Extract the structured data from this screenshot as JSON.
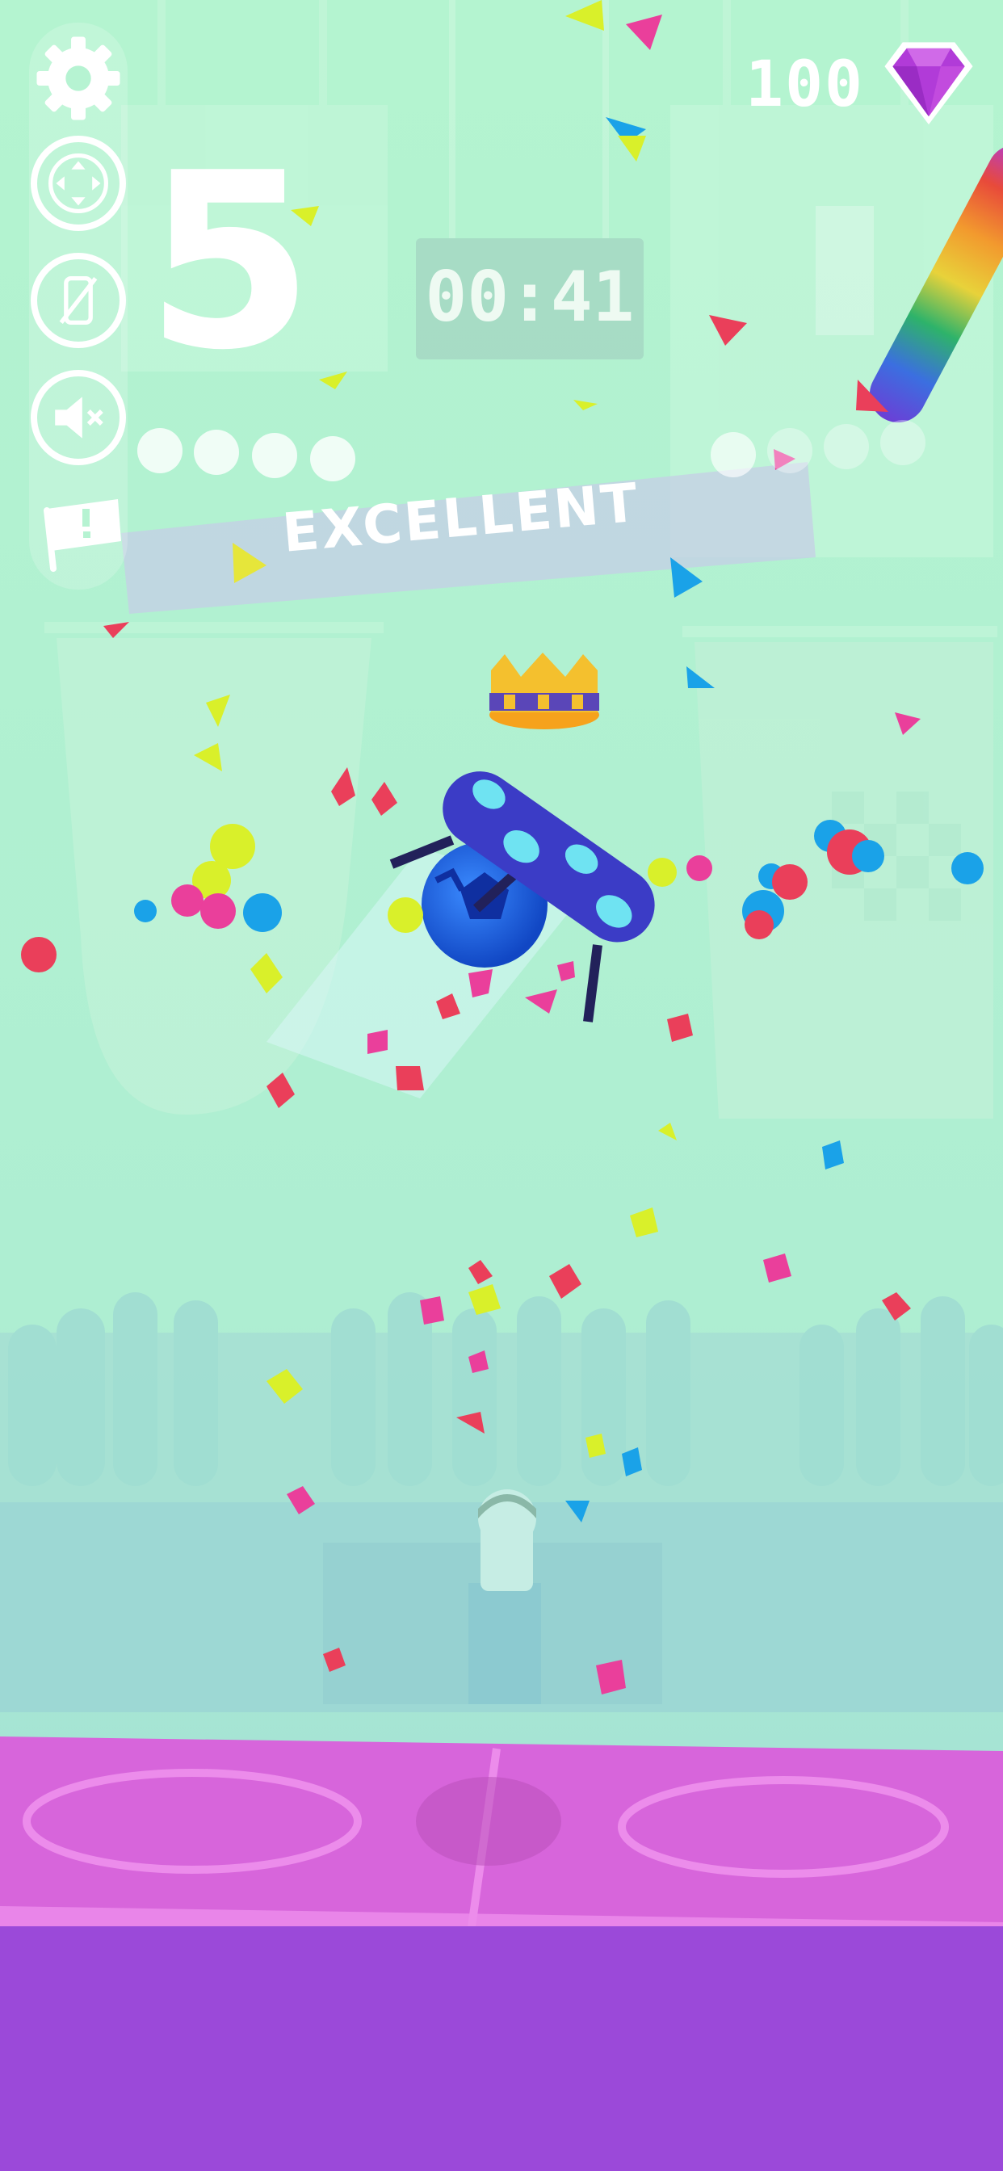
{
  "hud": {
    "buttons": [
      {
        "name": "settings",
        "icon": "gear-icon"
      },
      {
        "name": "controls",
        "icon": "joystick-icon"
      },
      {
        "name": "vibration",
        "icon": "vibration-off-icon"
      },
      {
        "name": "sound",
        "icon": "sound-muted-icon"
      },
      {
        "name": "report",
        "icon": "flag-icon"
      }
    ]
  },
  "score": {
    "level": "5",
    "progress_dots_total": 4
  },
  "timer": {
    "value": "00:41"
  },
  "currency": {
    "gems": "100",
    "icon": "gem-icon",
    "color": "#b13bd8"
  },
  "feedback": {
    "label": "EXCELLENT"
  },
  "opponent": {
    "score_bar": "I",
    "progress_dots_total": 4
  },
  "colors": {
    "background": "#b6f3d2",
    "field": "#d765db",
    "field_lower": "#9b49d9",
    "ball": "#1e6ee8",
    "crown": "#f2b320"
  }
}
